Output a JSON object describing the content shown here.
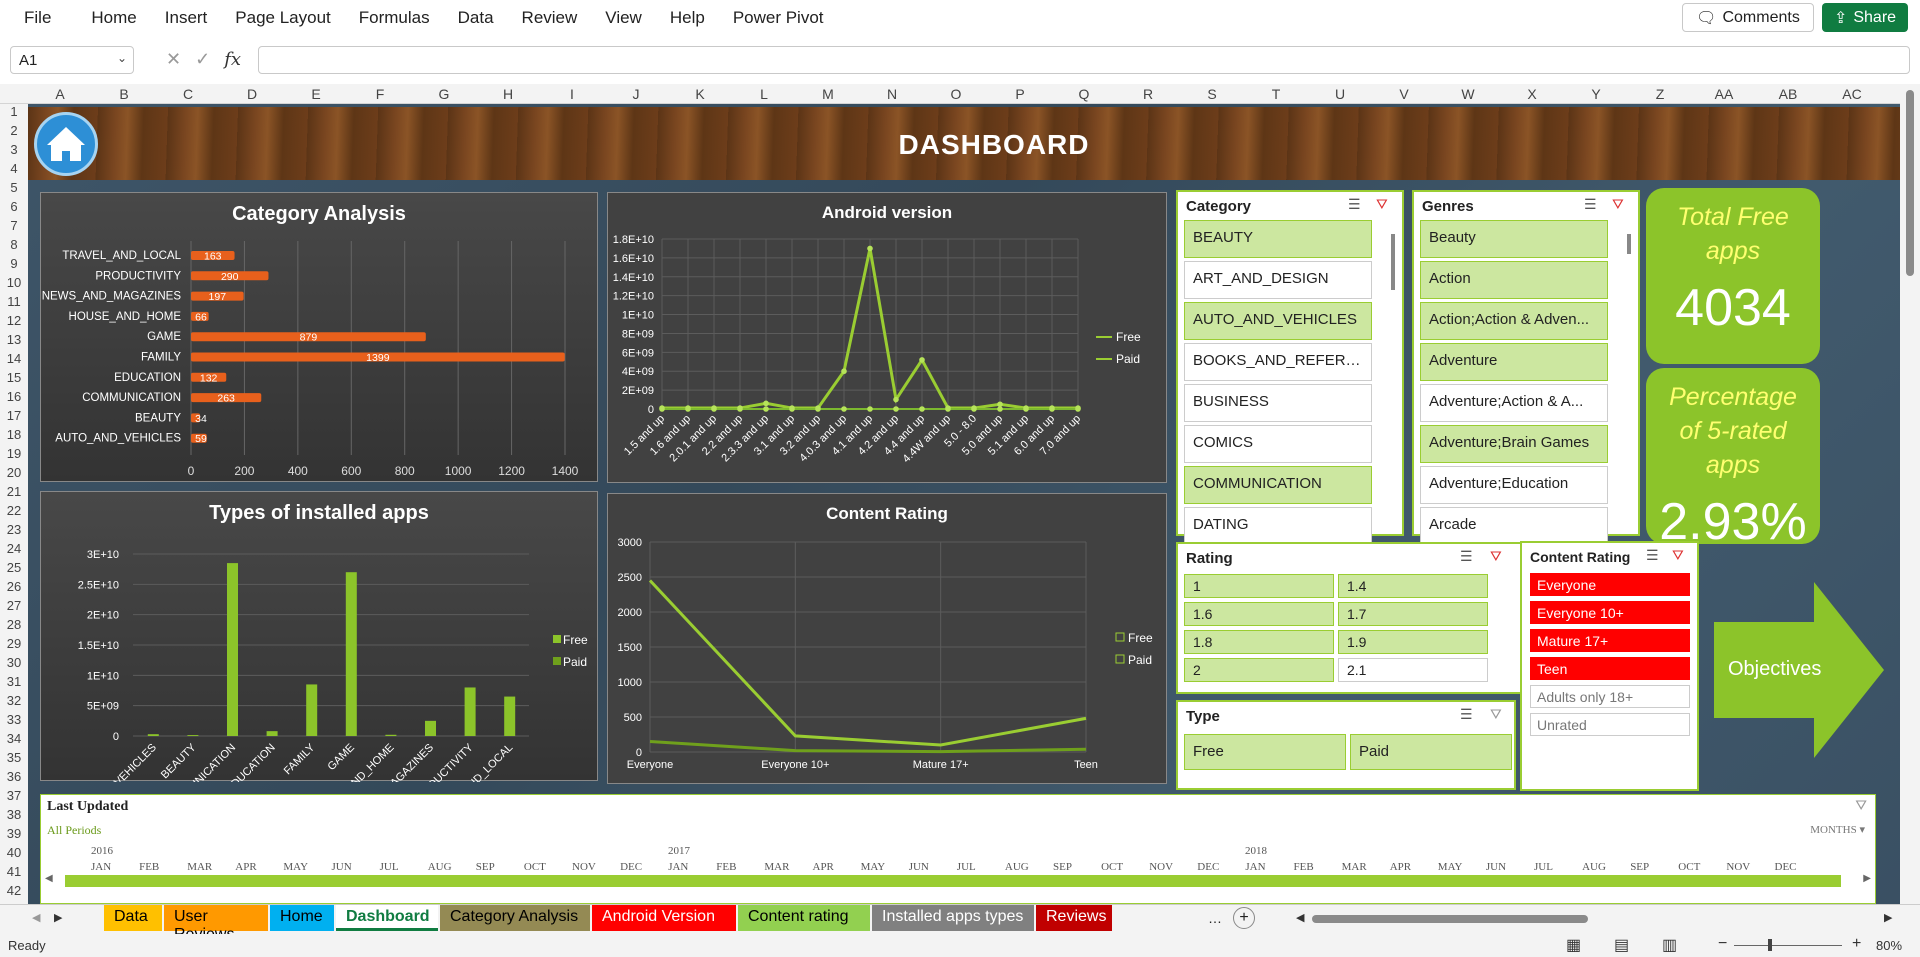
{
  "ribbon": {
    "tabs": [
      "File",
      "Home",
      "Insert",
      "Page Layout",
      "Formulas",
      "Data",
      "Review",
      "View",
      "Help",
      "Power Pivot"
    ],
    "comments_label": "Comments",
    "share_label": "Share"
  },
  "formula_bar": {
    "name_box": "A1",
    "fx_label": "fx",
    "formula": ""
  },
  "columns": [
    "A",
    "B",
    "C",
    "D",
    "E",
    "F",
    "G",
    "H",
    "I",
    "J",
    "K",
    "L",
    "M",
    "N",
    "O",
    "P",
    "Q",
    "R",
    "S",
    "T",
    "U",
    "V",
    "W",
    "X",
    "Y",
    "Z",
    "AA",
    "AB",
    "AC"
  ],
  "rows": [
    "1",
    "2",
    "3",
    "4",
    "5",
    "6",
    "7",
    "8",
    "9",
    "10",
    "11",
    "12",
    "13",
    "14",
    "15",
    "16",
    "17",
    "18",
    "19",
    "20",
    "21",
    "22",
    "23",
    "24",
    "25",
    "26",
    "27",
    "28",
    "29",
    "30",
    "31",
    "32",
    "33",
    "34",
    "35",
    "36",
    "37",
    "38",
    "39",
    "40",
    "41",
    "42"
  ],
  "dashboard": {
    "title": "DASHBOARD"
  },
  "colors": {
    "accent": "#9acd32",
    "bar_orange": "#e8601c",
    "active_red": "#ff0000",
    "share_green": "#107c41"
  },
  "category_chart_title": "Category Analysis",
  "android_chart_title": "Android version",
  "installed_chart_title": "Types of installed apps",
  "rating_chart_title": "Content Rating",
  "chart_data": [
    {
      "type": "bar",
      "title": "Category Analysis",
      "categories": [
        "TRAVEL_AND_LOCAL",
        "PRODUCTIVITY",
        "NEWS_AND_MAGAZINES",
        "HOUSE_AND_HOME",
        "GAME",
        "FAMILY",
        "EDUCATION",
        "COMMUNICATION",
        "BEAUTY",
        "AUTO_AND_VEHICLES"
      ],
      "values": [
        163,
        290,
        197,
        66,
        879,
        1399,
        132,
        263,
        34,
        59
      ],
      "xticks": [
        "0",
        "200",
        "400",
        "600",
        "800",
        "1000",
        "1200",
        "1400"
      ],
      "xlim": [
        0,
        1400
      ],
      "grid": true
    },
    {
      "type": "line",
      "title": "Android version",
      "categories": [
        "1.5 and up",
        "1.6 and up",
        "2.0.1 and up",
        "2.2 and up",
        "2.3.3 and up",
        "3.1 and up",
        "3.2 and up",
        "4.0.3 and up",
        "4.1 and up",
        "4.2 and up",
        "4.4 and up",
        "4.4W and up",
        "5.0 - 8.0",
        "5.0 and up",
        "5.1 and up",
        "6.0 and up",
        "7.0 and up"
      ],
      "series": [
        {
          "name": "Free",
          "values": [
            100000000.0,
            100000000.0,
            100000000.0,
            100000000.0,
            600000000.0,
            100000000.0,
            100000000.0,
            4000000000.0,
            17000000000.0,
            1000000000.0,
            5200000000.0,
            100000000.0,
            100000000.0,
            500000000.0,
            100000000.0,
            100000000.0,
            100000000.0
          ]
        },
        {
          "name": "Paid",
          "values": [
            0,
            0,
            0,
            0,
            0,
            0,
            0,
            0,
            0,
            0,
            0,
            0,
            0,
            0,
            0,
            0,
            0
          ]
        }
      ],
      "yticks": [
        "0",
        "2E+09",
        "4E+09",
        "6E+09",
        "8E+09",
        "1E+10",
        "1.2E+10",
        "1.4E+10",
        "1.6E+10",
        "1.8E+10"
      ],
      "ylim": [
        0,
        18000000000.0
      ],
      "legend": "right"
    },
    {
      "type": "bar",
      "title": "Types of installed apps",
      "categories": [
        "AUTO_AND_VEHICLES",
        "BEAUTY",
        "COMMUNICATION",
        "EDUCATION",
        "FAMILY",
        "GAME",
        "HOUSE_AND_HOME",
        "NEWS_AND_MAGAZINES",
        "PRODUCTIVITY",
        "TRAVEL_AND_LOCAL"
      ],
      "series": [
        {
          "name": "Free",
          "values": [
            300000000.0,
            150000000.0,
            28500000000.0,
            800000000.0,
            8500000000.0,
            27000000000.0,
            200000000.0,
            2500000000.0,
            8000000000.0,
            6500000000.0
          ]
        },
        {
          "name": "Paid",
          "values": [
            0,
            0,
            0,
            0,
            0,
            0,
            0,
            0,
            0,
            0
          ]
        }
      ],
      "yticks": [
        "0",
        "5E+09",
        "1E+10",
        "1.5E+10",
        "2E+10",
        "2.5E+10",
        "3E+10"
      ],
      "ylim": [
        0,
        30000000000.0
      ],
      "legend": "right"
    },
    {
      "type": "line",
      "title": "Content Rating",
      "categories": [
        "Everyone",
        "Everyone 10+",
        "Mature 17+",
        "Teen"
      ],
      "series": [
        {
          "name": "Free",
          "values": [
            2450,
            230,
            100,
            480
          ]
        },
        {
          "name": "Paid",
          "values": [
            150,
            20,
            5,
            40
          ]
        }
      ],
      "yticks": [
        "0",
        "500",
        "1000",
        "1500",
        "2000",
        "2500",
        "3000"
      ],
      "ylim": [
        0,
        3000
      ],
      "legend": "right"
    }
  ],
  "slicers": {
    "category": {
      "header": "Category",
      "items": [
        "BEAUTY",
        "ART_AND_DESIGN",
        "AUTO_AND_VEHICLES",
        "BOOKS_AND_REFERENCE",
        "BUSINESS",
        "COMICS",
        "COMMUNICATION",
        "DATING"
      ],
      "selected": [
        true,
        false,
        true,
        false,
        false,
        false,
        true,
        false
      ]
    },
    "genres": {
      "header": "Genres",
      "items": [
        "Beauty",
        "Action",
        "Action;Action & Adven...",
        "Adventure",
        "Adventure;Action & A...",
        "Adventure;Brain Games",
        "Adventure;Education",
        "Arcade"
      ],
      "selected": [
        true,
        true,
        true,
        true,
        false,
        true,
        false,
        false
      ]
    },
    "rating": {
      "header": "Rating",
      "items": [
        "1",
        "1.4",
        "1.6",
        "1.7",
        "1.8",
        "1.9",
        "2",
        "2.1"
      ],
      "selected": [
        true,
        true,
        true,
        true,
        true,
        true,
        true,
        false
      ]
    },
    "content_rating": {
      "header": "Content Rating",
      "items": [
        "Everyone",
        "Everyone 10+",
        "Mature 17+",
        "Teen",
        "Adults only 18+",
        "Unrated"
      ],
      "selected": [
        true,
        true,
        true,
        true,
        false,
        false
      ]
    },
    "type": {
      "header": "Type",
      "items": [
        "Free",
        "Paid"
      ],
      "selected": [
        true,
        true
      ]
    }
  },
  "kpis": {
    "total_free_label": "Total Free apps",
    "total_free_value": "4034",
    "pct5_label": "Percentage of 5-rated apps",
    "pct5_value": "2.93%"
  },
  "objectives_label": "Objectives",
  "timeline": {
    "header": "Last Updated",
    "period_label": "All Periods",
    "months_label": "MONTHS",
    "years": [
      "2016",
      "2017",
      "2018"
    ],
    "months": [
      "JAN",
      "FEB",
      "MAR",
      "APR",
      "MAY",
      "JUN",
      "JUL",
      "AUG",
      "SEP",
      "OCT",
      "NOV",
      "DEC",
      "JAN",
      "FEB",
      "MAR",
      "APR",
      "MAY",
      "JUN",
      "JUL",
      "AUG",
      "SEP",
      "OCT",
      "NOV",
      "DEC",
      "JAN",
      "FEB",
      "MAR",
      "APR",
      "MAY",
      "JUN",
      "JUL",
      "AUG",
      "SEP",
      "OCT",
      "NOV",
      "DEC"
    ]
  },
  "sheet_tabs": [
    {
      "label": "Data",
      "color": "#ffc000",
      "text": "#000000"
    },
    {
      "label": "User Reviews",
      "color": "#ff9900",
      "text": "#000000"
    },
    {
      "label": "Home",
      "color": "#00b0f0",
      "text": "#000000"
    },
    {
      "label": "Dashboard",
      "color": "#ffffff",
      "text": "#107c41"
    },
    {
      "label": "Category Analysis",
      "color": "#948a54",
      "text": "#000000"
    },
    {
      "label": "Android Version",
      "color": "#ff0000",
      "text": "#ffffff"
    },
    {
      "label": "Content rating",
      "color": "#92d050",
      "text": "#000000"
    },
    {
      "label": "Installed apps types",
      "color": "#808080",
      "text": "#ffffff"
    },
    {
      "label": "Reviews",
      "color": "#c00000",
      "text": "#ffffff"
    }
  ],
  "status": {
    "ready": "Ready",
    "zoom": "80%"
  }
}
